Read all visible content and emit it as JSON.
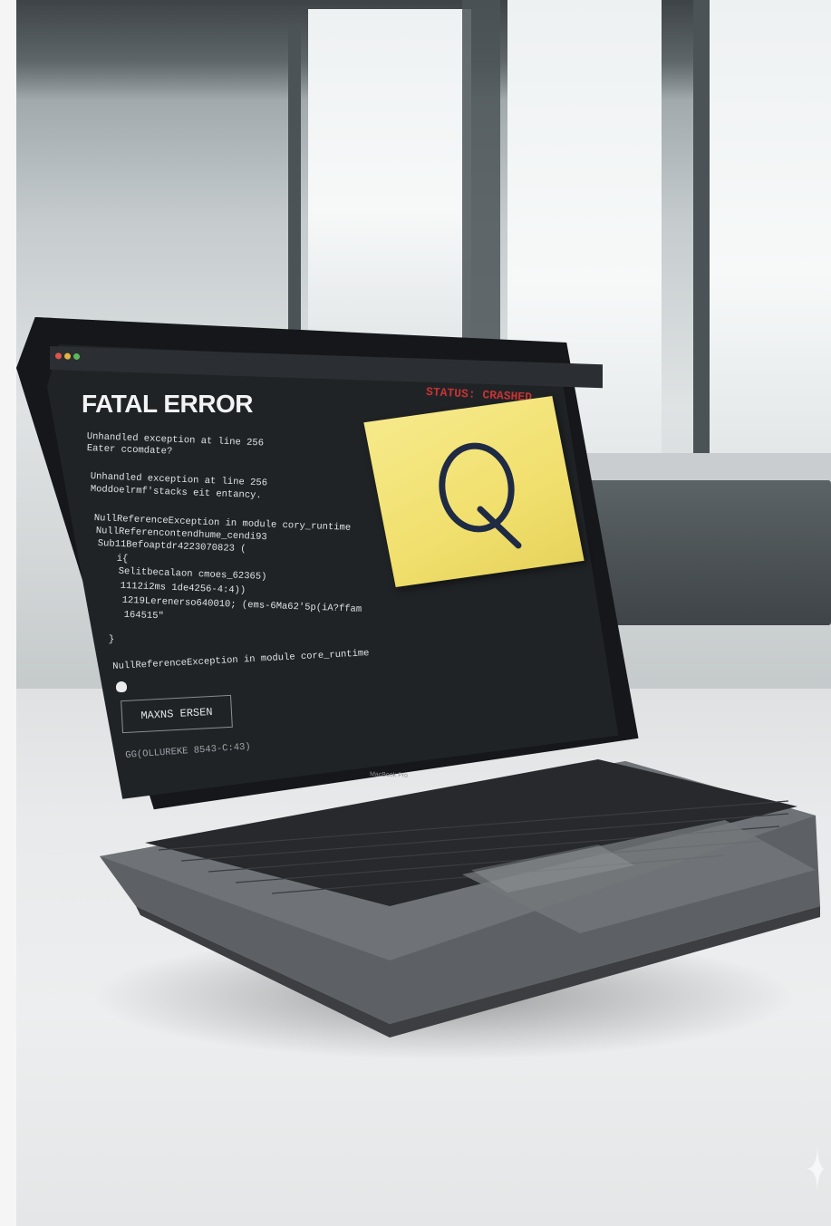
{
  "screen": {
    "heading": "FATAL ERROR",
    "status": "STATUS: CRASHED",
    "lines": [
      "Unhandled exception at line 256",
      "Eater ccomdate?",
      "",
      "Unhandled exception at line 256",
      "Moddoelrmf'stacks eit entancy.",
      "",
      "NullReferenceException in module cory_runtime",
      "NullReferencontendhume_cendi93",
      "Sub11Befoaptdr4223070823 (",
      "   i{",
      "   Selitbecalaon cmoes_62365)",
      "   1112i2ms 1de4256-4:4))",
      "   1219Lerenerso640010; (ems-6Ma62'5p(iA?ffam",
      "   164515\"",
      "}",
      "",
      "NullReferenceException in module core_runtime"
    ],
    "button_label": "MAXNS ERSEN",
    "footer_text": "GG(OLLUREKE 8543-C:43)"
  },
  "sticky_note": {
    "letter": "Q"
  },
  "laptop": {
    "model_label": "MacBook Pro"
  },
  "colors": {
    "sticky": "#f1e06e",
    "status_red": "#c53434",
    "screen_bg": "#202326"
  }
}
